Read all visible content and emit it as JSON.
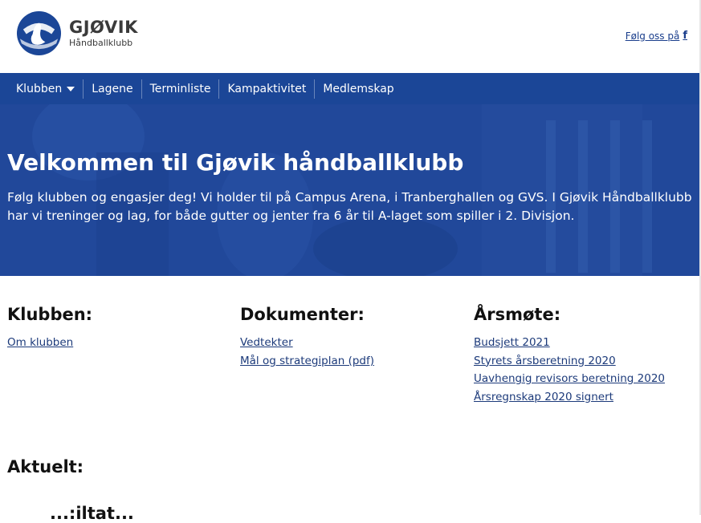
{
  "header": {
    "logo_name": "GJØVIK",
    "logo_sub": "Håndballklubb",
    "follow_label": "Følg oss på",
    "follow_icon": "facebook-icon"
  },
  "nav": {
    "items": [
      {
        "label": "Klubben"
      },
      {
        "label": "Lagene"
      },
      {
        "label": "Terminliste"
      },
      {
        "label": "Kampaktivitet"
      },
      {
        "label": "Medlemskap"
      }
    ],
    "background": "#1b4697"
  },
  "hero": {
    "title": "Velkommen til Gjøvik håndballklubb",
    "text": "Følg klubben og engasjer deg! Vi holder til på Campus Arena, i Tranberghallen og GVS. I Gjøvik Håndballklubb har vi treninger og lag, for både gutter og jenter fra 6 år til A-laget som spiller i 2. Divisjon.",
    "background": "#21489a"
  },
  "columns": [
    {
      "heading": "Klubben:",
      "links": [
        "Om klubben"
      ]
    },
    {
      "heading": "Dokumenter:",
      "links": [
        "Vedtekter",
        "Mål og strategiplan (pdf)"
      ]
    },
    {
      "heading": "Årsmøte:",
      "links": [
        "Budsjett 2021",
        "Styrets årsberetning 2020",
        "Uavhengig revisors beretning 2020",
        "Årsregnskap 2020 signert"
      ]
    }
  ],
  "aktuelt": {
    "heading": "Aktuelt:",
    "partial_text": "...:iltat..."
  },
  "colors": {
    "brand_blue": "#1b4697",
    "link": "#1c3a7a"
  }
}
